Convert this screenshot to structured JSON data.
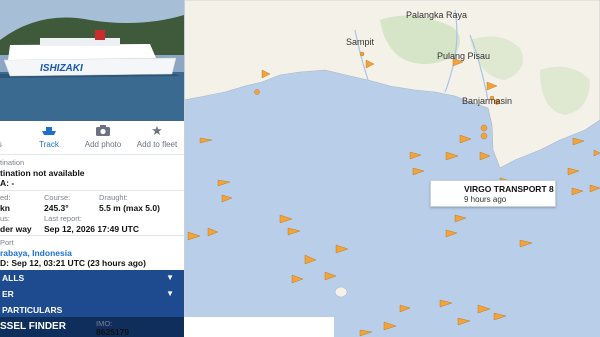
{
  "map": {
    "places": [
      {
        "id": "palangka-raya",
        "label": "Palangka Raya"
      },
      {
        "id": "sampit",
        "label": "Sampit"
      },
      {
        "id": "pulang-pisau",
        "label": "Pulang Pisau"
      },
      {
        "id": "banjarmasin",
        "label": "Banjarmasin"
      }
    ],
    "colors": {
      "sea": "#b9cfe9",
      "land": "#f4f1e8",
      "forest": "#d6e4c8",
      "vessel": "#f2a33a",
      "selected": "#e0314f"
    },
    "selected_vessel": {
      "name": "VIRGO TRANSPORT 8",
      "last_seen": "9 hours ago"
    }
  },
  "vessel": {
    "photo_caption": "ISHIZAKI",
    "tabs": [
      {
        "id": "details",
        "label": "ls",
        "icon": "info-icon"
      },
      {
        "id": "track",
        "label": "Track",
        "icon": "ship-icon",
        "active": true
      },
      {
        "id": "add-photo",
        "label": "Add photo",
        "icon": "camera-icon"
      },
      {
        "id": "add-to-fleet",
        "label": "Add to fleet",
        "icon": "star-icon"
      }
    ],
    "destination_label": "tination",
    "destination_value": "tination not available",
    "eta_value": "A: -",
    "speed_label": "ed:",
    "speed_value": "kn",
    "course_label": "Course:",
    "course_value": "245.3°",
    "draught_label": "Draught:",
    "draught_value": "5.5 m (max 5.0)",
    "status_label": "us:",
    "status_value": "der way",
    "last_report_label": "Last report:",
    "last_report_value": "Sep 12, 2026 17:49 UTC",
    "last_port_label": "Port",
    "last_port_value": "rabaya, Indonesia",
    "atd_value": "D: Sep 12, 03:21 UTC (23 hours ago)",
    "sections": [
      "ALLS",
      "ER",
      "PARTICULARS"
    ],
    "finder_label": "SSEL FINDER",
    "imo_label": "IMO:",
    "imo_value": "8625179"
  }
}
